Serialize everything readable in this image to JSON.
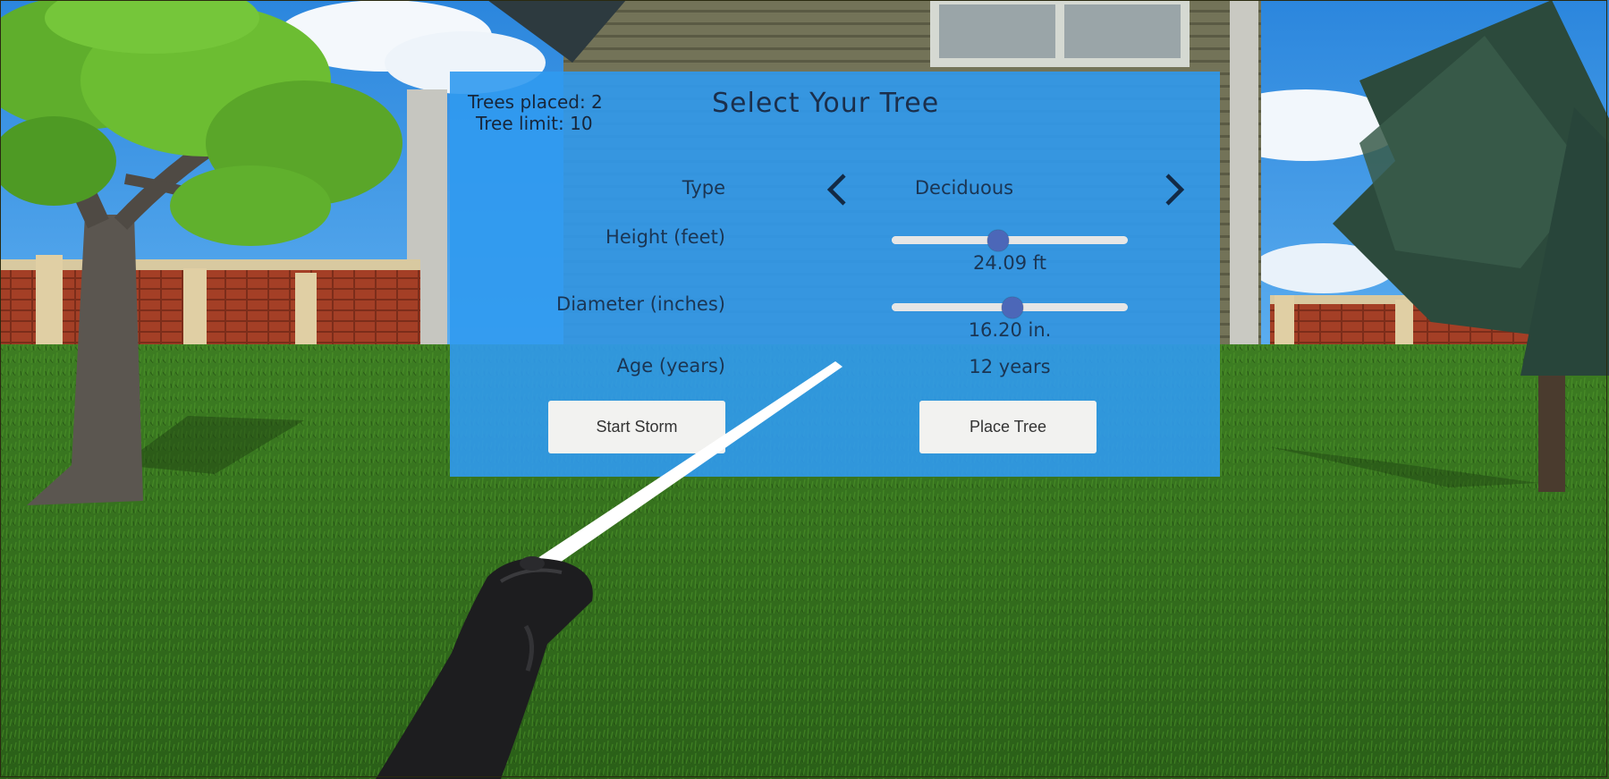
{
  "hud": {
    "trees_placed": "Trees placed: 2",
    "tree_limit": "Tree limit: 10"
  },
  "panel": {
    "title": "Select Your Tree",
    "type_label": "Type",
    "type_value": "Deciduous",
    "height_label": "Height (feet)",
    "height_value": "24.09 ft",
    "height_slider_fraction": 0.45,
    "diameter_label": "Diameter (inches)",
    "diameter_value": "16.20 in.",
    "diameter_slider_fraction": 0.51,
    "age_label": "Age (years)",
    "age_value": "12 years",
    "prev_icon": "chevron-left-icon",
    "next_icon": "chevron-right-icon",
    "start_storm_label": "Start Storm",
    "place_tree_label": "Place Tree"
  },
  "colors": {
    "panel": "#309AF0",
    "slider_thumb": "#4C67B8",
    "button_bg": "#F2F2F0",
    "sky": "#2F8FE0",
    "grass": "#2E6A1A",
    "fence_brick": "#9E3B24",
    "house_siding": "#6E6E56",
    "controller": "#1E1E1E",
    "laser": "#FFFFFF"
  }
}
